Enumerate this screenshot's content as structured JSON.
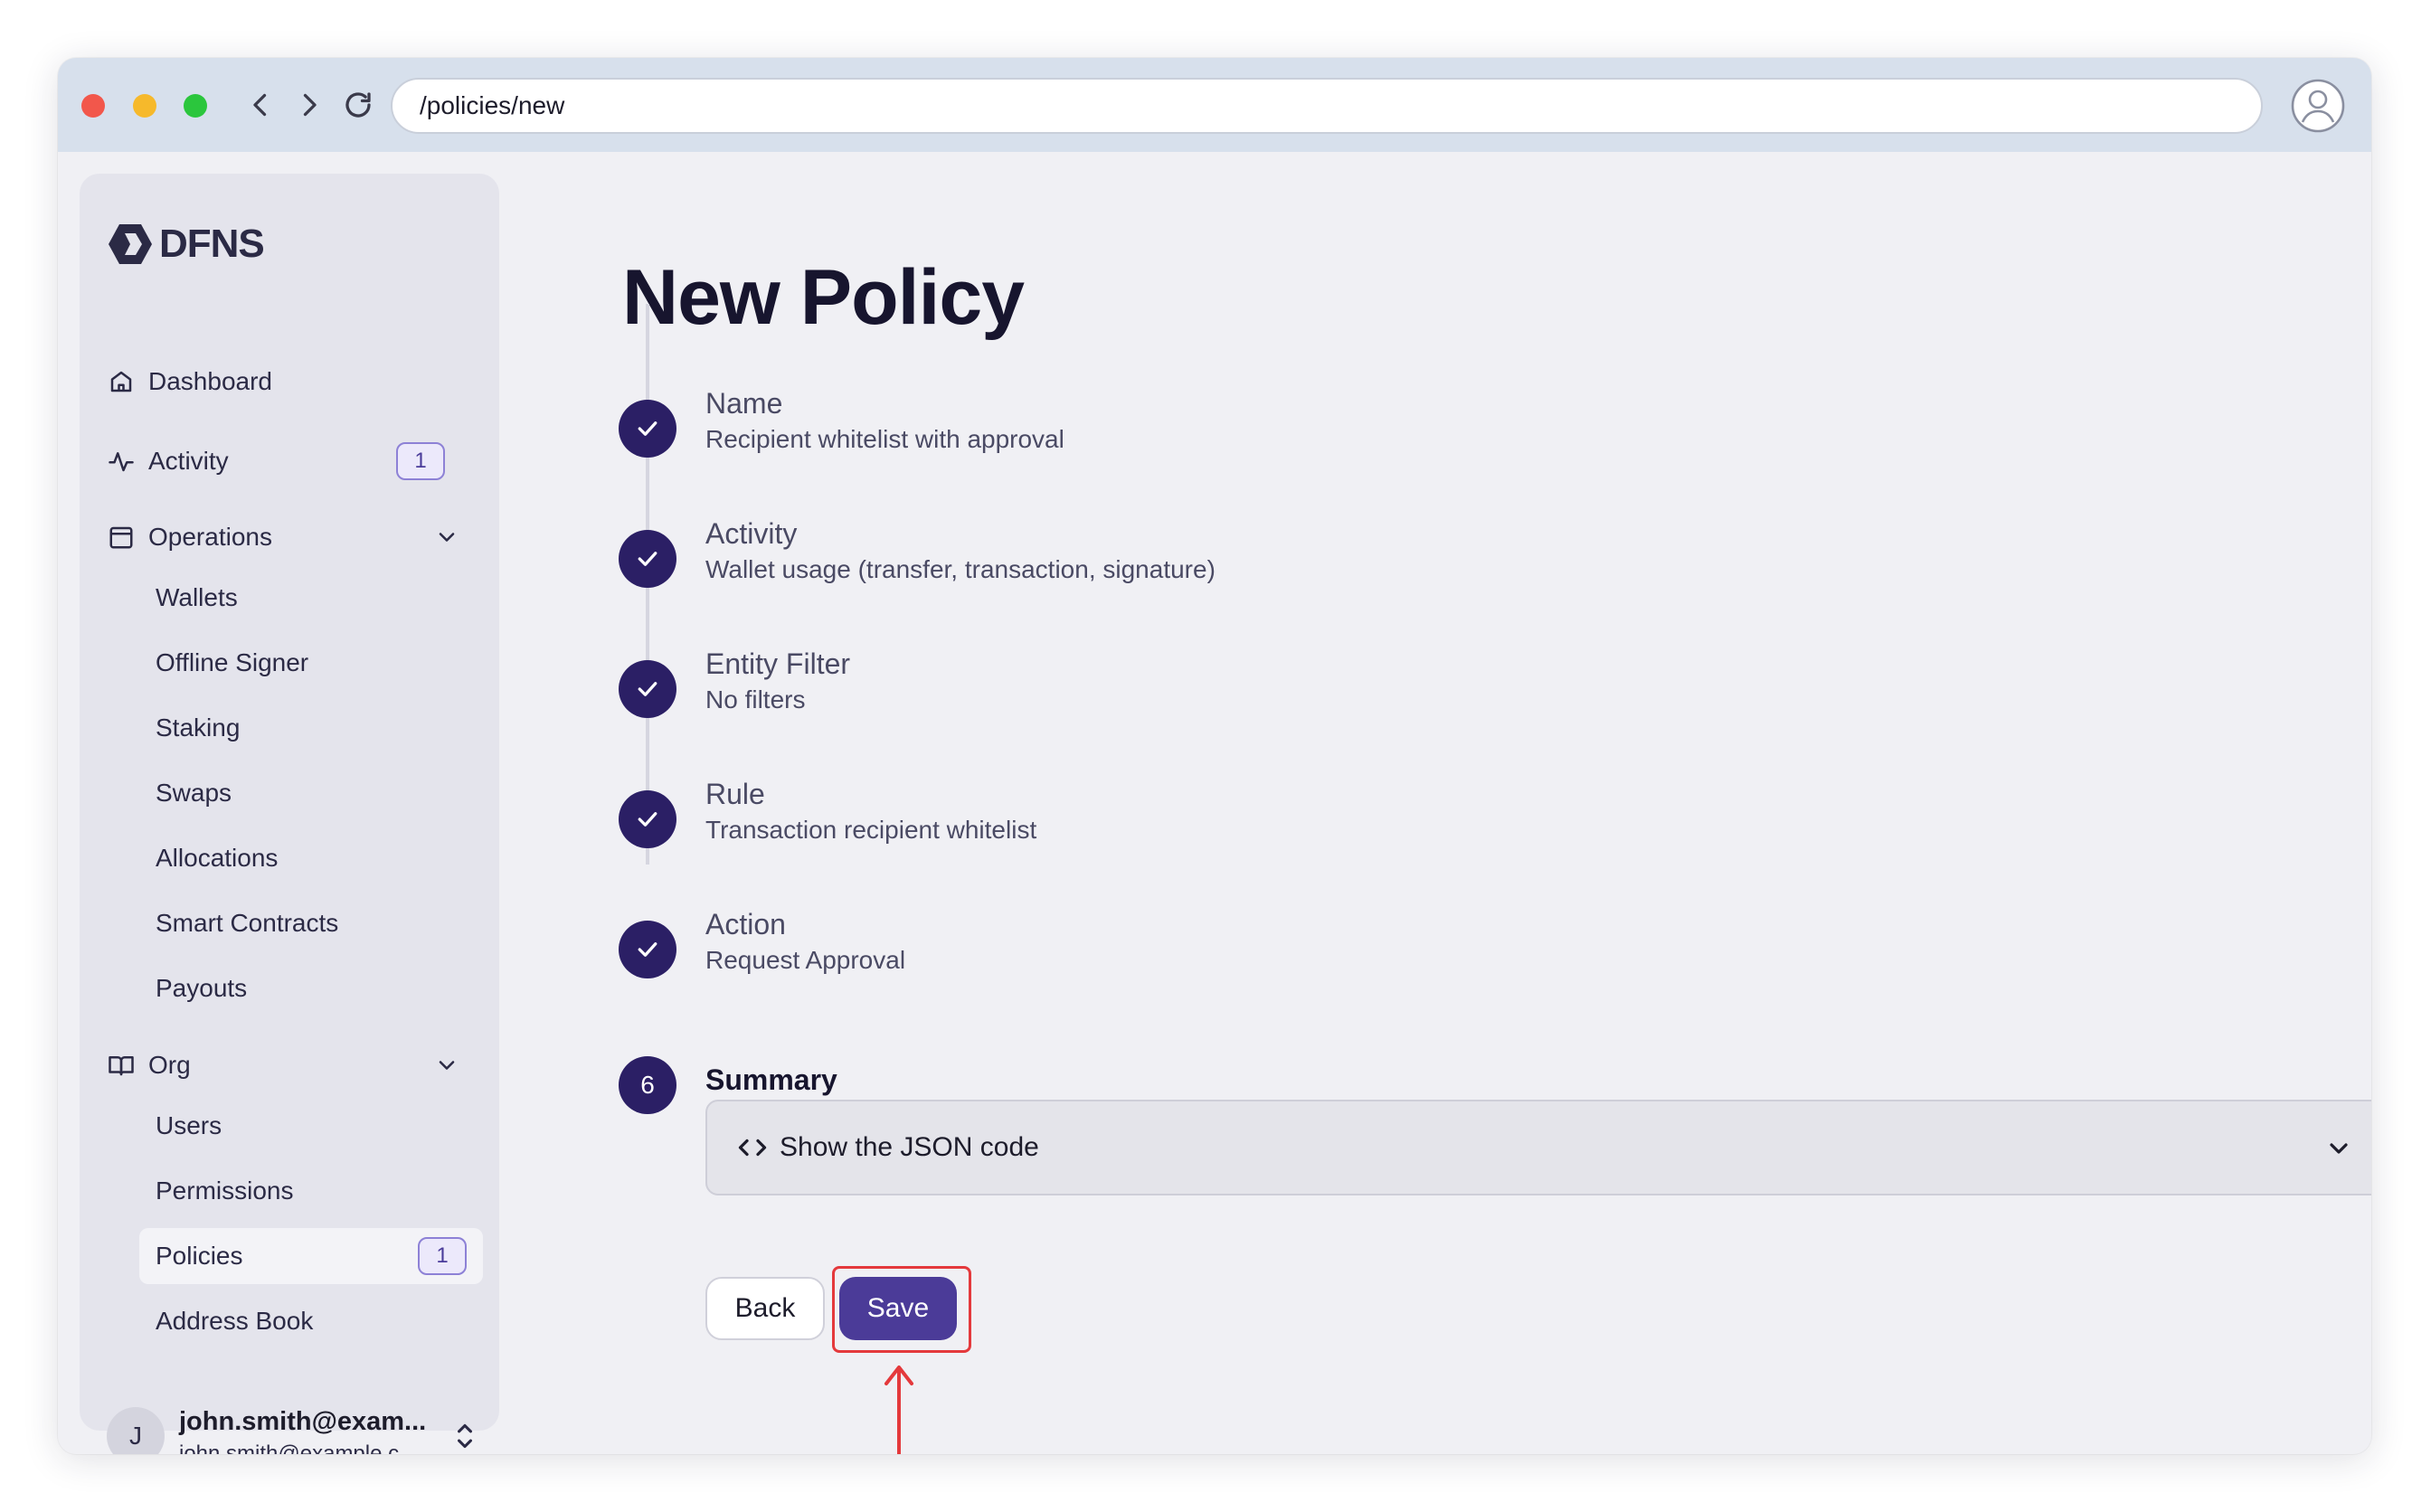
{
  "browser": {
    "url": "/policies/new",
    "icons": [
      "back-arrow-icon",
      "forward-arrow-icon",
      "reload-icon",
      "user-profile-icon"
    ]
  },
  "sidebar": {
    "logo_text": "DFNS",
    "dashboard": {
      "label": "Dashboard",
      "icon": "home-icon"
    },
    "activity": {
      "label": "Activity",
      "icon": "activity-pulse-icon",
      "badge": "1"
    },
    "operations": {
      "label": "Operations",
      "icon": "calendar-icon",
      "items": [
        "Wallets",
        "Offline Signer",
        "Staking",
        "Swaps",
        "Allocations",
        "Smart Contracts",
        "Payouts"
      ]
    },
    "org": {
      "label": "Org",
      "icon": "book-icon",
      "items": [
        "Users",
        "Permissions",
        "Policies",
        "Address Book"
      ],
      "active_item": "Policies",
      "policies_badge": "1"
    },
    "user": {
      "initial": "J",
      "name": "john.smith@exam...",
      "email": "john.smith@example.c..."
    }
  },
  "main": {
    "title": "New Policy",
    "steps": [
      {
        "title": "Name",
        "value": "Recipient whitelist with approval",
        "status": "done"
      },
      {
        "title": "Activity",
        "value": "Wallet usage (transfer, transaction, signature)",
        "status": "done"
      },
      {
        "title": "Entity Filter",
        "value": "No filters",
        "status": "done"
      },
      {
        "title": "Rule",
        "value": "Transaction recipient whitelist",
        "status": "done"
      },
      {
        "title": "Action",
        "value": "Request Approval",
        "status": "done"
      },
      {
        "title": "Summary",
        "number": "6",
        "status": "current"
      }
    ],
    "json_toggle_label": "Show the JSON code",
    "back_label": "Back",
    "save_label": "Save"
  },
  "colors": {
    "accent": "#4b3b98",
    "step_circle": "#2b1f65",
    "highlight": "#e4393c",
    "badge_border": "#8d81d6"
  }
}
